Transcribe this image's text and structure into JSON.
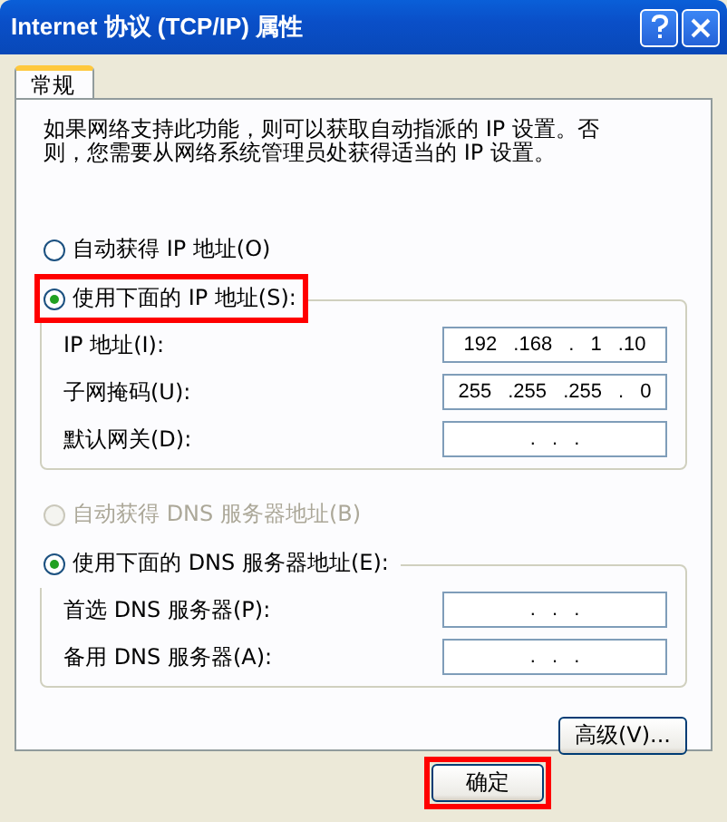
{
  "window": {
    "title": "Internet 协议 (TCP/IP) 属性"
  },
  "tabs": [
    {
      "label": "常规",
      "selected": true
    }
  ],
  "description": "如果网络支持此功能，则可以获取自动指派的 IP 设置。否则，您需要从网络系统管理员处获得适当的 IP 设置。",
  "ip_section": {
    "options": [
      {
        "label": "自动获得 IP 地址(O)",
        "selected": false,
        "disabled": false,
        "highlighted": false
      },
      {
        "label": "使用下面的 IP 地址(S):",
        "selected": true,
        "disabled": false,
        "highlighted": true
      }
    ],
    "fields": [
      {
        "label": "IP 地址(I):",
        "value": "192 .168 . 1 .10"
      },
      {
        "label": "子网掩码(U):",
        "value": "255 .255 .255 . 0"
      },
      {
        "label": "默认网关(D):",
        "value": ". . ."
      }
    ]
  },
  "dns_section": {
    "options": [
      {
        "label": "自动获得 DNS 服务器地址(B)",
        "selected": false,
        "disabled": true,
        "highlighted": false
      },
      {
        "label": "使用下面的 DNS 服务器地址(E):",
        "selected": true,
        "disabled": false,
        "highlighted": false
      }
    ],
    "fields": [
      {
        "label": "首选 DNS 服务器(P):",
        "value": ". . ."
      },
      {
        "label": "备用 DNS 服务器(A):",
        "value": ". . ."
      }
    ]
  },
  "advanced_button": "高级(V)...",
  "buttons": [
    {
      "label": "确定",
      "highlighted": true
    }
  ]
}
